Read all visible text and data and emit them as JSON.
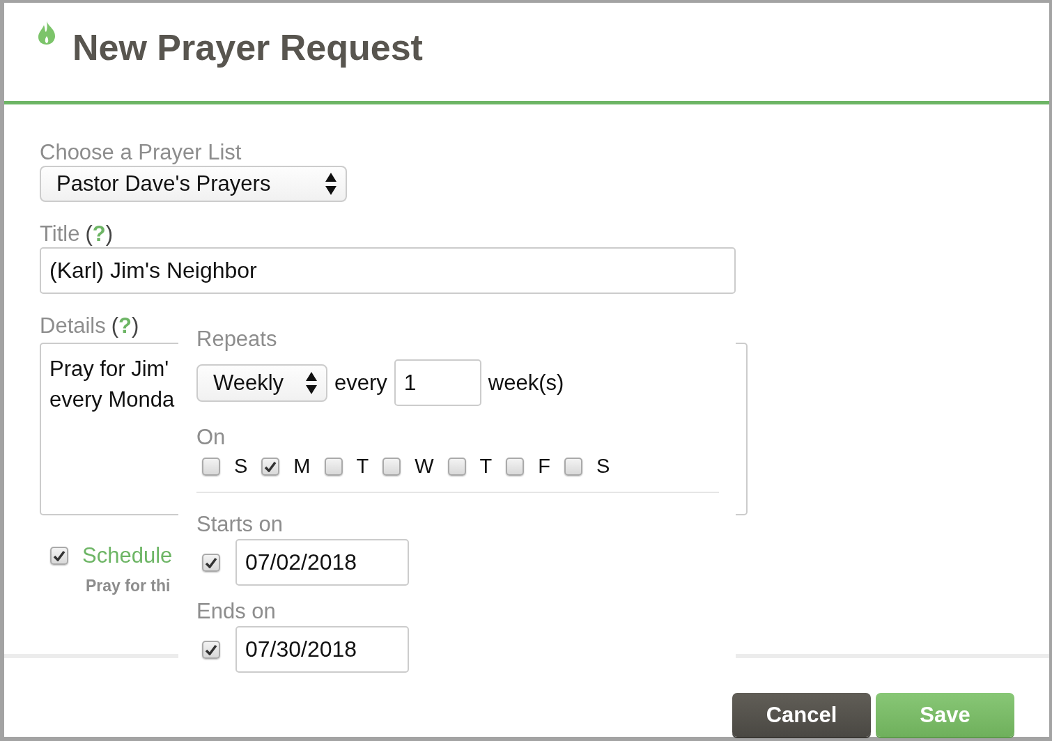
{
  "dialog": {
    "title": "New Prayer Request"
  },
  "prayer_list": {
    "label": "Choose a Prayer List",
    "value": "Pastor Dave's Prayers"
  },
  "title_field": {
    "label": "Title",
    "help": "(**?**)",
    "value": "(Karl) Jim's Neighbor"
  },
  "details": {
    "label": "Details",
    "help": "(**?**)",
    "lines": [
      "Pray for Jim'",
      "every Monda"
    ]
  },
  "schedule": {
    "checked": true,
    "label": "Schedule",
    "hint": "Pray for thi"
  },
  "repeat_popover": {
    "repeats_label": "Repeats",
    "frequency": "Weekly",
    "every_label": "every",
    "interval": "1",
    "unit": "week(s)",
    "on_label": "On",
    "days": [
      {
        "label": "S",
        "checked": false
      },
      {
        "label": "M",
        "checked": true
      },
      {
        "label": "T",
        "checked": false
      },
      {
        "label": "W",
        "checked": false
      },
      {
        "label": "T",
        "checked": false
      },
      {
        "label": "F",
        "checked": false
      },
      {
        "label": "S",
        "checked": false
      }
    ],
    "starts": {
      "label": "Starts on",
      "checked": true,
      "value": "07/02/2018"
    },
    "ends": {
      "label": "Ends on",
      "checked": true,
      "value": "07/30/2018"
    }
  },
  "buttons": [
    {
      "label": "Cancel",
      "kind": "secondary"
    },
    {
      "label": "Save",
      "kind": "primary"
    }
  ]
}
